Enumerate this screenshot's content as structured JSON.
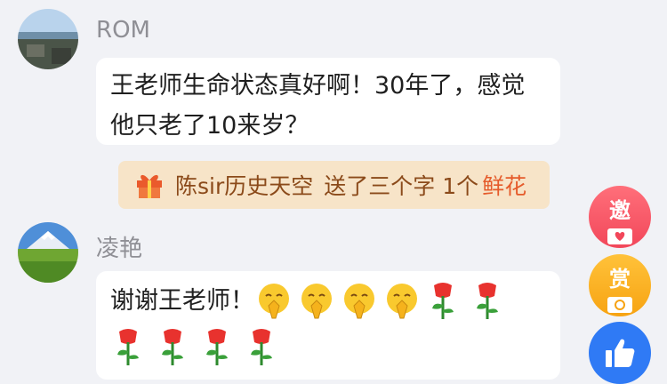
{
  "comments": [
    {
      "username": "ROM",
      "lines": [
        "王老师生命状态真好啊！30年了，感觉",
        "他只老了10来岁？"
      ]
    },
    {
      "username": "凌艳",
      "text": "谢谢王老师！"
    }
  ],
  "gift": {
    "sender": "陈sir历史天空",
    "action": "送了三个字 1个",
    "item": "鲜花"
  },
  "side_buttons": {
    "invite": "邀",
    "reward": "赏"
  },
  "colors": {
    "background": "#f1f2f6",
    "gift_bg": "#f7e4c8",
    "gift_accent": "#e55b2b",
    "invite": "#f2475a",
    "reward": "#f7a312",
    "like": "#2f7af5"
  },
  "icons": [
    "gift-icon",
    "heart-icon",
    "thumbs-up-icon",
    "praying-emoji-icon",
    "rose-icon"
  ]
}
